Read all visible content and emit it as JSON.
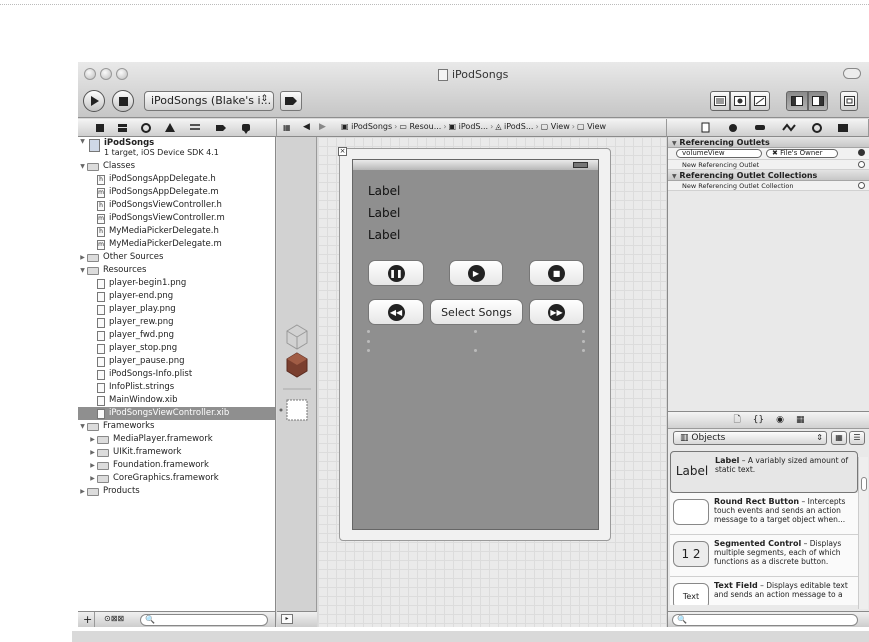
{
  "window": {
    "title": "iPodSongs",
    "scheme": "iPodSongs (Blake's i..."
  },
  "jumpbar": {
    "crumbs": [
      "iPodSongs",
      "Resou...",
      "iPodS...",
      "iPodS...",
      "View",
      "View"
    ]
  },
  "navigator": {
    "project_name": "iPodSongs",
    "project_sub": "1 target, iOS Device SDK 4.1",
    "items": [
      {
        "label": "Classes",
        "type": "group",
        "level": 0,
        "open": true
      },
      {
        "label": "iPodSongsAppDelegate.h",
        "type": "file",
        "level": 1,
        "badge": "h"
      },
      {
        "label": "iPodSongsAppDelegate.m",
        "type": "file",
        "level": 1,
        "badge": "m"
      },
      {
        "label": "iPodSongsViewController.h",
        "type": "file",
        "level": 1,
        "badge": "h"
      },
      {
        "label": "iPodSongsViewController.m",
        "type": "file",
        "level": 1,
        "badge": "m"
      },
      {
        "label": "MyMediaPickerDelegate.h",
        "type": "file",
        "level": 1,
        "badge": "h"
      },
      {
        "label": "MyMediaPickerDelegate.m",
        "type": "file",
        "level": 1,
        "badge": "m"
      },
      {
        "label": "Other Sources",
        "type": "group",
        "level": 0,
        "open": false
      },
      {
        "label": "Resources",
        "type": "group",
        "level": 0,
        "open": true
      },
      {
        "label": "player-begin1.png",
        "type": "file",
        "level": 1,
        "badge": ""
      },
      {
        "label": "player-end.png",
        "type": "file",
        "level": 1,
        "badge": ""
      },
      {
        "label": "player_play.png",
        "type": "file",
        "level": 1,
        "badge": ""
      },
      {
        "label": "player_rew.png",
        "type": "file",
        "level": 1,
        "badge": ""
      },
      {
        "label": "player_fwd.png",
        "type": "file",
        "level": 1,
        "badge": ""
      },
      {
        "label": "player_stop.png",
        "type": "file",
        "level": 1,
        "badge": ""
      },
      {
        "label": "player_pause.png",
        "type": "file",
        "level": 1,
        "badge": ""
      },
      {
        "label": "iPodSongs-Info.plist",
        "type": "file",
        "level": 1,
        "badge": ""
      },
      {
        "label": "InfoPlist.strings",
        "type": "file",
        "level": 1,
        "badge": ""
      },
      {
        "label": "MainWindow.xib",
        "type": "file",
        "level": 1,
        "badge": ""
      },
      {
        "label": "iPodSongsViewController.xib",
        "type": "file",
        "level": 1,
        "badge": "",
        "selected": true
      },
      {
        "label": "Frameworks",
        "type": "group",
        "level": 0,
        "open": true
      },
      {
        "label": "MediaPlayer.framework",
        "type": "group",
        "level": 1,
        "open": false
      },
      {
        "label": "UIKit.framework",
        "type": "group",
        "level": 1,
        "open": false
      },
      {
        "label": "Foundation.framework",
        "type": "group",
        "level": 1,
        "open": false
      },
      {
        "label": "CoreGraphics.framework",
        "type": "group",
        "level": 1,
        "open": false
      },
      {
        "label": "Products",
        "type": "group",
        "level": 0,
        "open": false
      }
    ]
  },
  "canvas": {
    "labels": [
      "Label",
      "Label",
      "Label"
    ],
    "select_songs": "Select Songs"
  },
  "inspector": {
    "section1": "Referencing Outlets",
    "outlet_name": "volumeView",
    "outlet_target": "File's Owner",
    "new_outlet": "New Referencing Outlet",
    "section2": "Referencing Outlet Collections",
    "new_collection": "New Referencing Outlet Collection"
  },
  "library": {
    "selector": "Objects",
    "items": [
      {
        "icon_text": "Label",
        "title": "Label",
        "desc": " – A variably sized amount of static text."
      },
      {
        "icon_text": "",
        "title": "Round Rect Button",
        "desc": " – Intercepts touch events and sends an action message to a target object when..."
      },
      {
        "icon_text": "1 2",
        "title": "Segmented Control",
        "desc": " – Displays multiple segments, each of which functions as a discrete button."
      },
      {
        "icon_text": "Text",
        "title": "Text Field",
        "desc": " – Displays editable text and sends an action message to a"
      }
    ]
  }
}
